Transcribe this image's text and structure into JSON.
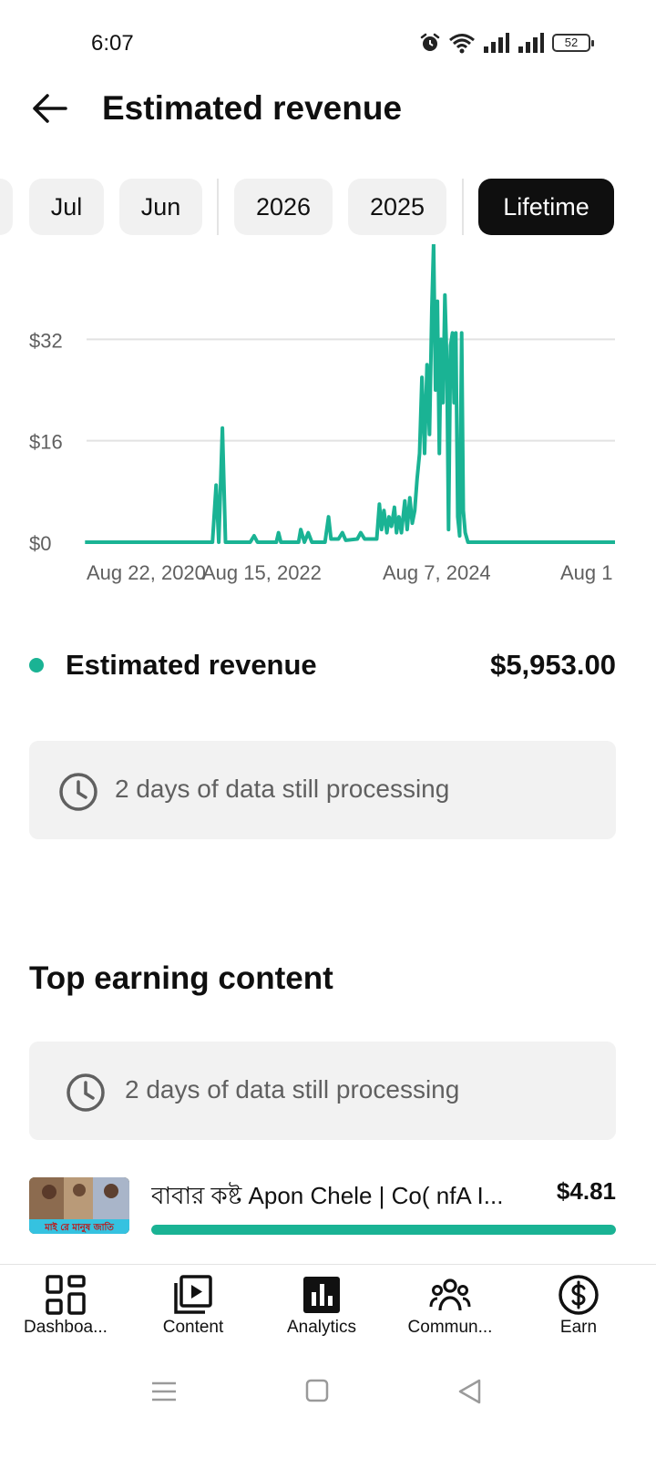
{
  "status_bar": {
    "time": "6:07",
    "battery": "52"
  },
  "header": {
    "title": "Estimated revenue"
  },
  "period_chips": [
    {
      "label": "Jul",
      "active": false
    },
    {
      "label": "Jun",
      "active": false
    },
    {
      "label": "2026",
      "active": false
    },
    {
      "label": "2025",
      "active": false
    },
    {
      "label": "Lifetime",
      "active": true
    }
  ],
  "chart_data": {
    "type": "line",
    "title": "",
    "xlabel": "",
    "ylabel": "",
    "y_tick_labels": [
      "$0",
      "$16",
      "$32"
    ],
    "y_ticks": [
      0,
      16,
      32
    ],
    "ylim": [
      0,
      47
    ],
    "x_tick_labels": [
      "Aug 22, 2020",
      "Aug 15, 2022",
      "Aug 7, 2024",
      "Aug 1"
    ],
    "x_tick_dates": [
      "2020-08-22",
      "2022-08-15",
      "2024-08-07",
      "2026-08-01"
    ],
    "grid": true,
    "series": [
      {
        "color": "#1ab394",
        "points": [
          [
            "2020-08-01",
            0
          ],
          [
            "2022-01-10",
            0
          ],
          [
            "2022-01-25",
            9
          ],
          [
            "2022-02-05",
            0
          ],
          [
            "2022-02-20",
            18
          ],
          [
            "2022-03-05",
            0
          ],
          [
            "2022-06-15",
            0
          ],
          [
            "2022-07-01",
            1
          ],
          [
            "2022-07-15",
            0
          ],
          [
            "2022-10-01",
            0
          ],
          [
            "2022-10-10",
            1.5
          ],
          [
            "2022-10-20",
            0
          ],
          [
            "2023-01-01",
            0
          ],
          [
            "2023-01-10",
            2
          ],
          [
            "2023-01-25",
            0
          ],
          [
            "2023-02-10",
            1.5
          ],
          [
            "2023-02-25",
            0
          ],
          [
            "2023-04-20",
            0
          ],
          [
            "2023-05-05",
            4
          ],
          [
            "2023-05-15",
            0.5
          ],
          [
            "2023-06-15",
            0.5
          ],
          [
            "2023-07-01",
            1.5
          ],
          [
            "2023-07-15",
            0.3
          ],
          [
            "2023-09-01",
            0.5
          ],
          [
            "2023-09-15",
            1.5
          ],
          [
            "2023-10-01",
            0.5
          ],
          [
            "2023-11-20",
            0.5
          ],
          [
            "2023-12-01",
            6
          ],
          [
            "2023-12-10",
            2
          ],
          [
            "2023-12-20",
            5
          ],
          [
            "2024-01-01",
            1.5
          ],
          [
            "2024-01-10",
            4
          ],
          [
            "2024-01-20",
            2.5
          ],
          [
            "2024-02-01",
            5.5
          ],
          [
            "2024-02-10",
            1.5
          ],
          [
            "2024-02-20",
            4
          ],
          [
            "2024-03-01",
            1.5
          ],
          [
            "2024-03-15",
            6.5
          ],
          [
            "2024-03-25",
            2
          ],
          [
            "2024-04-05",
            7
          ],
          [
            "2024-04-15",
            3
          ],
          [
            "2024-04-25",
            5
          ],
          [
            "2024-05-05",
            10
          ],
          [
            "2024-05-15",
            14
          ],
          [
            "2024-05-25",
            26
          ],
          [
            "2024-06-05",
            14
          ],
          [
            "2024-06-15",
            28
          ],
          [
            "2024-06-25",
            17
          ],
          [
            "2024-07-05",
            37
          ],
          [
            "2024-07-12",
            47
          ],
          [
            "2024-07-20",
            24
          ],
          [
            "2024-07-28",
            38
          ],
          [
            "2024-08-05",
            14
          ],
          [
            "2024-08-12",
            32
          ],
          [
            "2024-08-20",
            22
          ],
          [
            "2024-08-28",
            39
          ],
          [
            "2024-09-05",
            28
          ],
          [
            "2024-09-12",
            2
          ],
          [
            "2024-09-20",
            31
          ],
          [
            "2024-09-28",
            33
          ],
          [
            "2024-10-05",
            22
          ],
          [
            "2024-10-12",
            33
          ],
          [
            "2024-10-20",
            4
          ],
          [
            "2024-10-28",
            1
          ],
          [
            "2024-11-05",
            33
          ],
          [
            "2024-11-12",
            5
          ],
          [
            "2024-11-20",
            1.5
          ],
          [
            "2024-12-01",
            0
          ],
          [
            "2026-08-01",
            0
          ]
        ]
      }
    ]
  },
  "summary": {
    "label": "Estimated revenue",
    "value": "$5,953.00",
    "legend_color": "#1ab394"
  },
  "processing_notice_1": {
    "text": "2 days of data still processing"
  },
  "top_earning": {
    "title": "Top earning content",
    "notice": "2 days of data still processing",
    "items": [
      {
        "title": "বাবার কষ্ট Apon Chele | Co( nfA I...",
        "value": "$4.81",
        "share": 1.0,
        "thumb_caption": "মাই রে মানুষ জাতি"
      }
    ]
  },
  "bottom_nav": [
    {
      "label": "Dashboa...",
      "icon": "dashboard-icon"
    },
    {
      "label": "Content",
      "icon": "content-icon"
    },
    {
      "label": "Analytics",
      "icon": "analytics-icon"
    },
    {
      "label": "Commun...",
      "icon": "community-icon"
    },
    {
      "label": "Earn",
      "icon": "earn-icon"
    }
  ]
}
